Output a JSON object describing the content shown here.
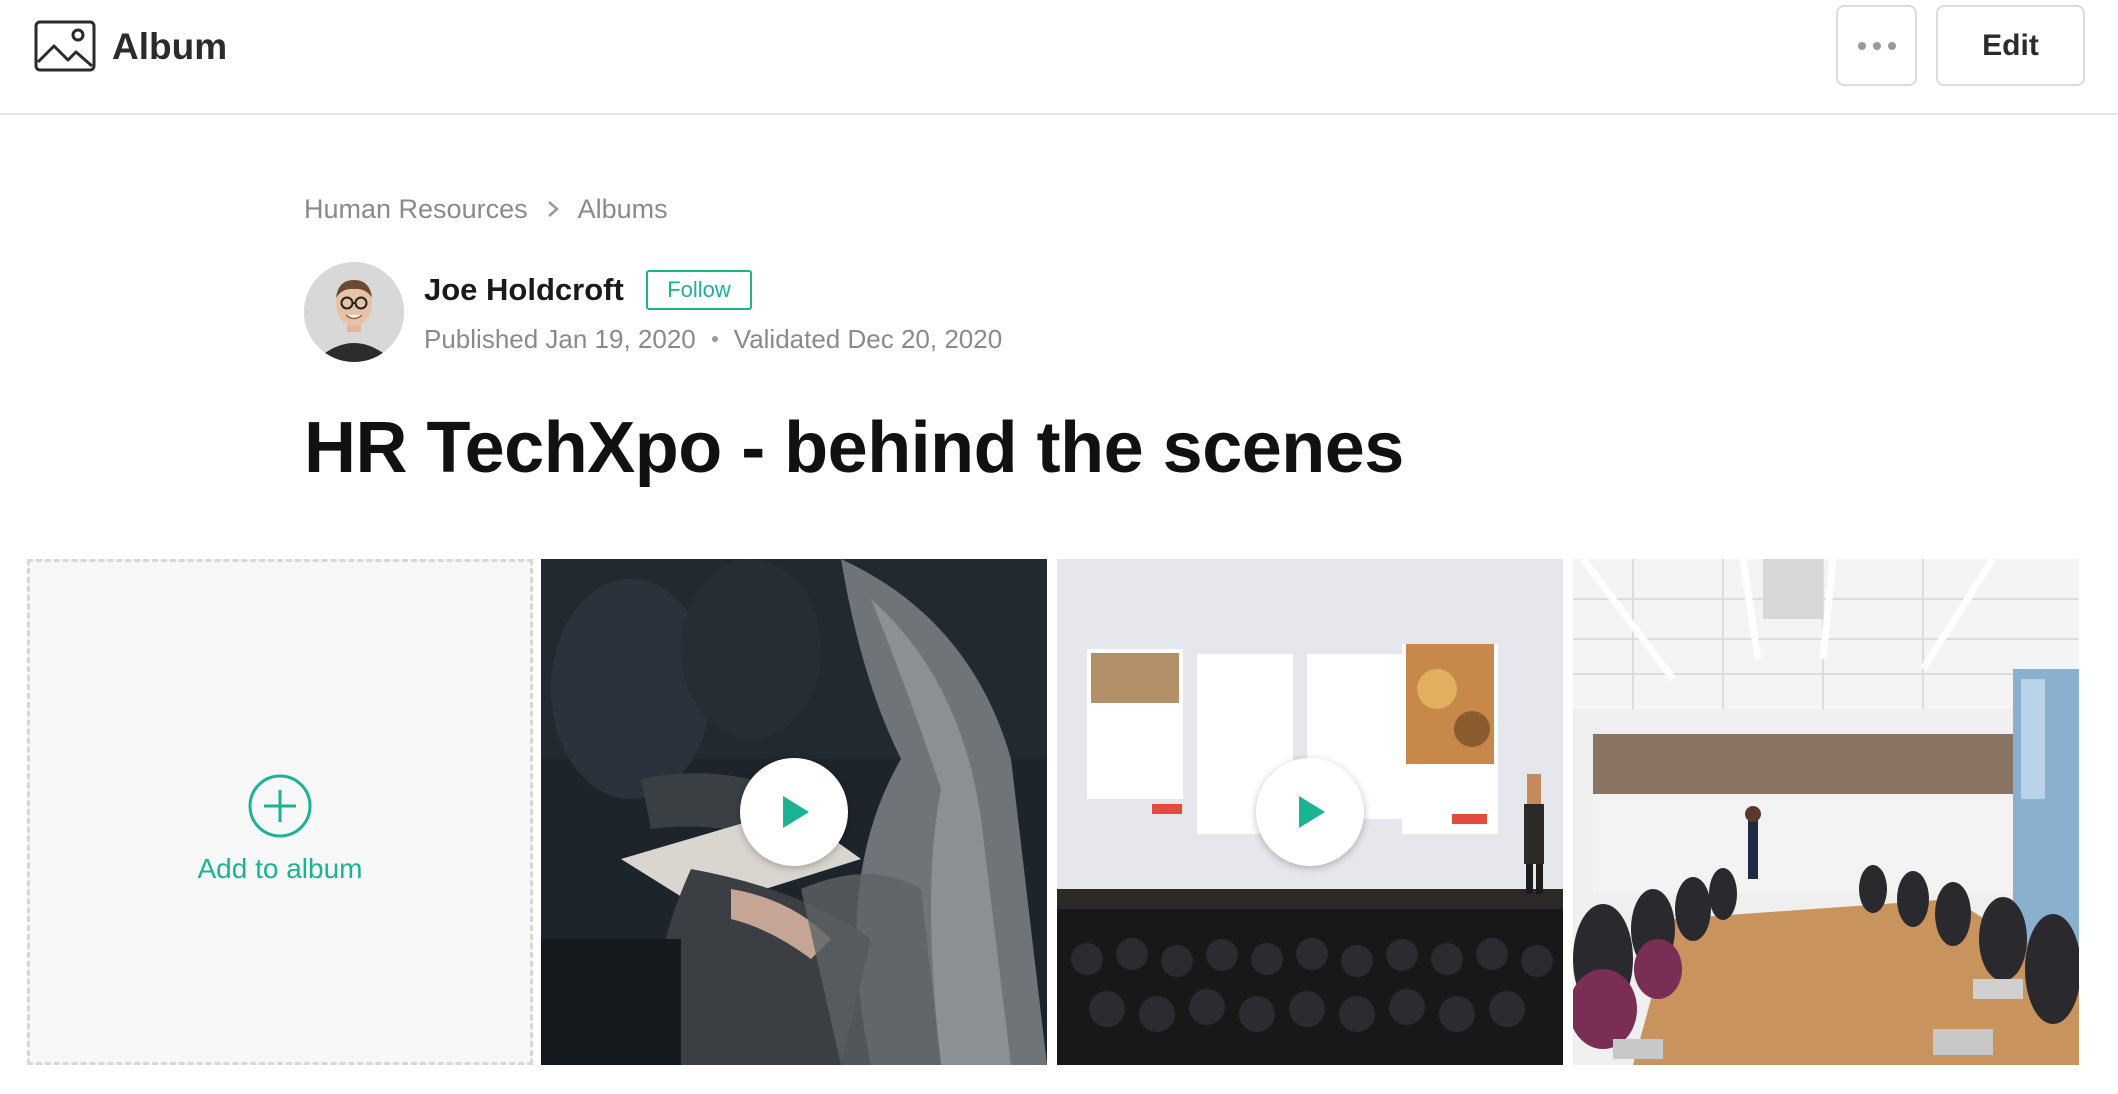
{
  "header": {
    "app_title": "Album",
    "more_label": "",
    "edit_label": "Edit"
  },
  "breadcrumb": {
    "items": [
      "Human Resources",
      "Albums"
    ]
  },
  "author": {
    "name": "Joe Holdcroft",
    "follow_label": "Follow",
    "published": "Published Jan 19, 2020",
    "validated": "Validated Dec 20, 2020"
  },
  "page": {
    "title": "HR TechXpo - behind the scenes"
  },
  "gallery": {
    "add_label": "Add to album",
    "items": [
      {
        "type": "video",
        "icon": "play-icon"
      },
      {
        "type": "video",
        "icon": "play-icon"
      },
      {
        "type": "photo"
      }
    ]
  },
  "colors": {
    "accent": "#1ab394",
    "muted_text": "#8a8a8a",
    "border": "#dcdcdc"
  }
}
